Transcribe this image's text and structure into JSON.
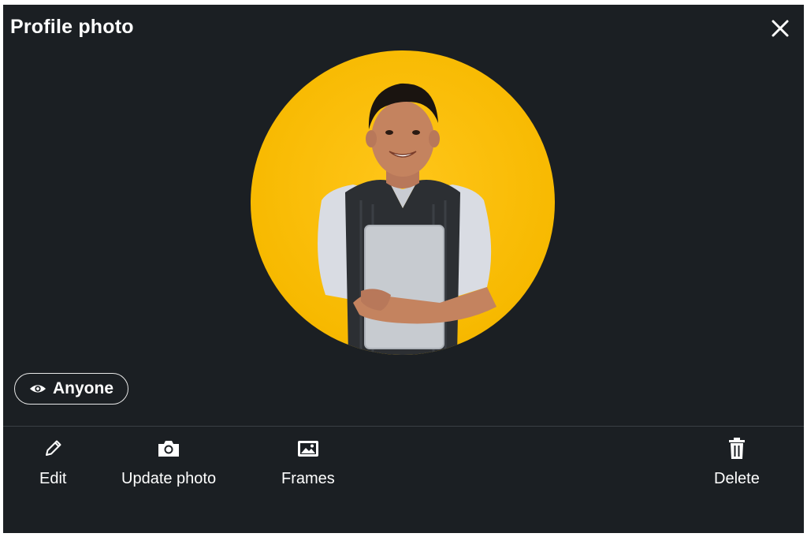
{
  "dialog": {
    "title": "Profile photo",
    "close_icon": "close-icon"
  },
  "photo": {
    "background_color": "#f7b900",
    "description_icon": "profile-photo"
  },
  "visibility": {
    "icon": "eye-icon",
    "label": "Anyone"
  },
  "actions": [
    {
      "icon": "pencil-icon",
      "label": "Edit"
    },
    {
      "icon": "camera-icon",
      "label": "Update photo"
    },
    {
      "icon": "image-icon",
      "label": "Frames"
    },
    {
      "icon": "trash-icon",
      "label": "Delete"
    }
  ],
  "colors": {
    "background": "#1b1f23",
    "text": "#ffffff",
    "accent_photo_bg": "#f7b900"
  }
}
